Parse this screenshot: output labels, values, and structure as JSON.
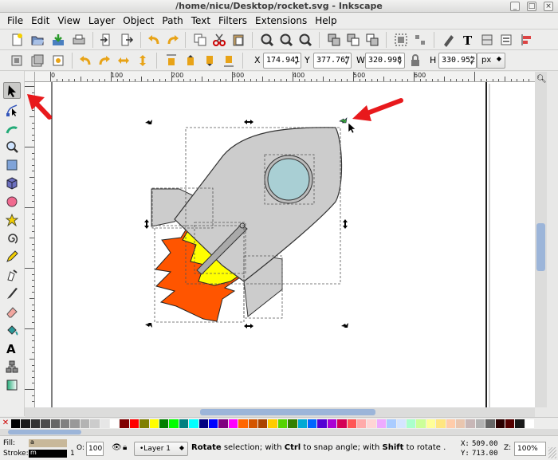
{
  "window": {
    "title": "/home/nicu/Desktop/rocket.svg - Inkscape",
    "buttons": [
      "_",
      "□",
      "×"
    ]
  },
  "menu": [
    "File",
    "Edit",
    "View",
    "Layer",
    "Object",
    "Path",
    "Text",
    "Filters",
    "Extensions",
    "Help"
  ],
  "commands_bar": {
    "icons": [
      "new-document-icon",
      "open-icon",
      "save-icon",
      "print-icon",
      "import-icon",
      "export-icon",
      "undo-icon",
      "redo-icon",
      "copy-icon",
      "cut-icon",
      "paste-icon",
      "zoom-selection-icon",
      "zoom-drawing-icon",
      "zoom-page-icon",
      "duplicate-icon",
      "clone-icon",
      "unlink-clone-icon",
      "group-icon",
      "ungroup-icon",
      "fill-stroke-icon",
      "text-font-icon",
      "layers-icon",
      "align-icon"
    ]
  },
  "tool_controls": {
    "icons": [
      "select-all-icon",
      "select-all-layers-icon",
      "deselect-icon",
      "rotate-ccw-icon",
      "rotate-cw-icon",
      "flip-horizontal-icon",
      "flip-vertical-icon",
      "raise-to-top-icon",
      "raise-icon",
      "lower-icon",
      "lower-to-bottom-icon"
    ],
    "x_label": "X",
    "x_value": "174.941",
    "y_label": "Y",
    "y_value": "377.767",
    "w_label": "W",
    "w_value": "320.998",
    "lock_icon": "lock-icon",
    "h_label": "H",
    "h_value": "330.952",
    "unit": "px"
  },
  "toolbox": {
    "tools": [
      "selector",
      "node",
      "tweak",
      "zoom",
      "rectangle",
      "3d-box",
      "ellipse",
      "star",
      "spiral",
      "pencil",
      "pen",
      "calligraphy",
      "eraser",
      "paint-bucket",
      "text",
      "connector",
      "gradient"
    ],
    "active": "selector"
  },
  "ruler": {
    "labels": [
      "0",
      "100",
      "200",
      "300",
      "400",
      "500",
      "600"
    ]
  },
  "palette": {
    "colors": [
      "#000000",
      "#1a1a1a",
      "#333333",
      "#4d4d4d",
      "#666666",
      "#808080",
      "#999999",
      "#b3b3b3",
      "#cccccc",
      "#e6e6e6",
      "#ffffff",
      "#800000",
      "#ff0000",
      "#808000",
      "#ffff00",
      "#008000",
      "#00ff00",
      "#008080",
      "#00ffff",
      "#000080",
      "#0000ff",
      "#800080",
      "#ff00ff",
      "#ff6600",
      "#d45500",
      "#aa4400",
      "#ffcc00",
      "#55d400",
      "#338000",
      "#00aad4",
      "#0066ff",
      "#5500d4",
      "#aa00d4",
      "#d40055",
      "#ff5555",
      "#ffaaaa",
      "#ffd5d5",
      "#eeaaff",
      "#aaccff",
      "#d5e5ff",
      "#aaffcc",
      "#ccff99",
      "#ffff99",
      "#ffe680",
      "#ffccaa",
      "#e9c6af",
      "#c8b7b7",
      "#b3b3b3",
      "#666666",
      "#2b0000",
      "#550000",
      "#1a1a1a",
      "#ffffff"
    ]
  },
  "status": {
    "fill_label": "Fill:",
    "fill_value": "a",
    "stroke_label": "Stroke:",
    "stroke_value": "m",
    "stroke_width": "1",
    "opacity_label": "O:",
    "opacity_value": "100",
    "layer": "•Layer 1",
    "message_bold1": "Rotate",
    "message_part1": " selection; with ",
    "message_bold2": "Ctrl",
    "message_part2": " to snap angle; with ",
    "message_bold3": "Shift",
    "message_part3": " to rotate .",
    "x_label": "X:",
    "x_value": "509.00",
    "y_label": "Y:",
    "y_value": "713.00",
    "zoom_label": "Z:",
    "zoom_value": "100%"
  },
  "colors": {
    "rocket_body": "#cccccc",
    "rocket_outline": "#333333",
    "window_glass": "#a9cfd4",
    "flame_outer": "#ff5500",
    "flame_inner": "#ffff00",
    "annotation_arrow": "#e8191c",
    "scroll_thumb": "#9cb5d9"
  }
}
